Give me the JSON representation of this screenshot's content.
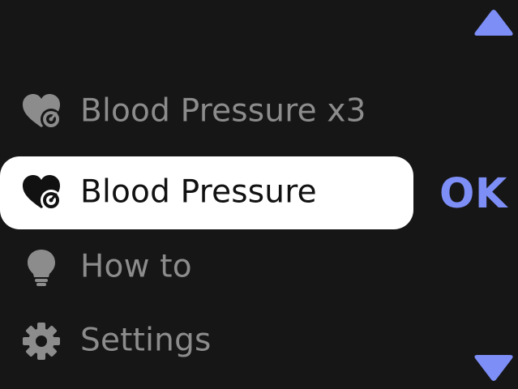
{
  "menu": {
    "items": [
      {
        "label": "Blood Pressure x3",
        "icon": "heart-gauge-icon",
        "selected": false
      },
      {
        "label": "Blood Pressure",
        "icon": "heart-gauge-icon",
        "selected": true
      },
      {
        "label": "How to",
        "icon": "lightbulb-icon",
        "selected": false
      },
      {
        "label": "Settings",
        "icon": "gear-icon",
        "selected": false
      }
    ]
  },
  "controls": {
    "ok_label": "OK",
    "up_icon": "triangle-up-icon",
    "down_icon": "triangle-down-icon"
  },
  "colors": {
    "background": "#161616",
    "accent": "#7d8ef7",
    "inactive_text": "#8c8c8c",
    "selected_bg": "#ffffff",
    "selected_text": "#111111"
  }
}
